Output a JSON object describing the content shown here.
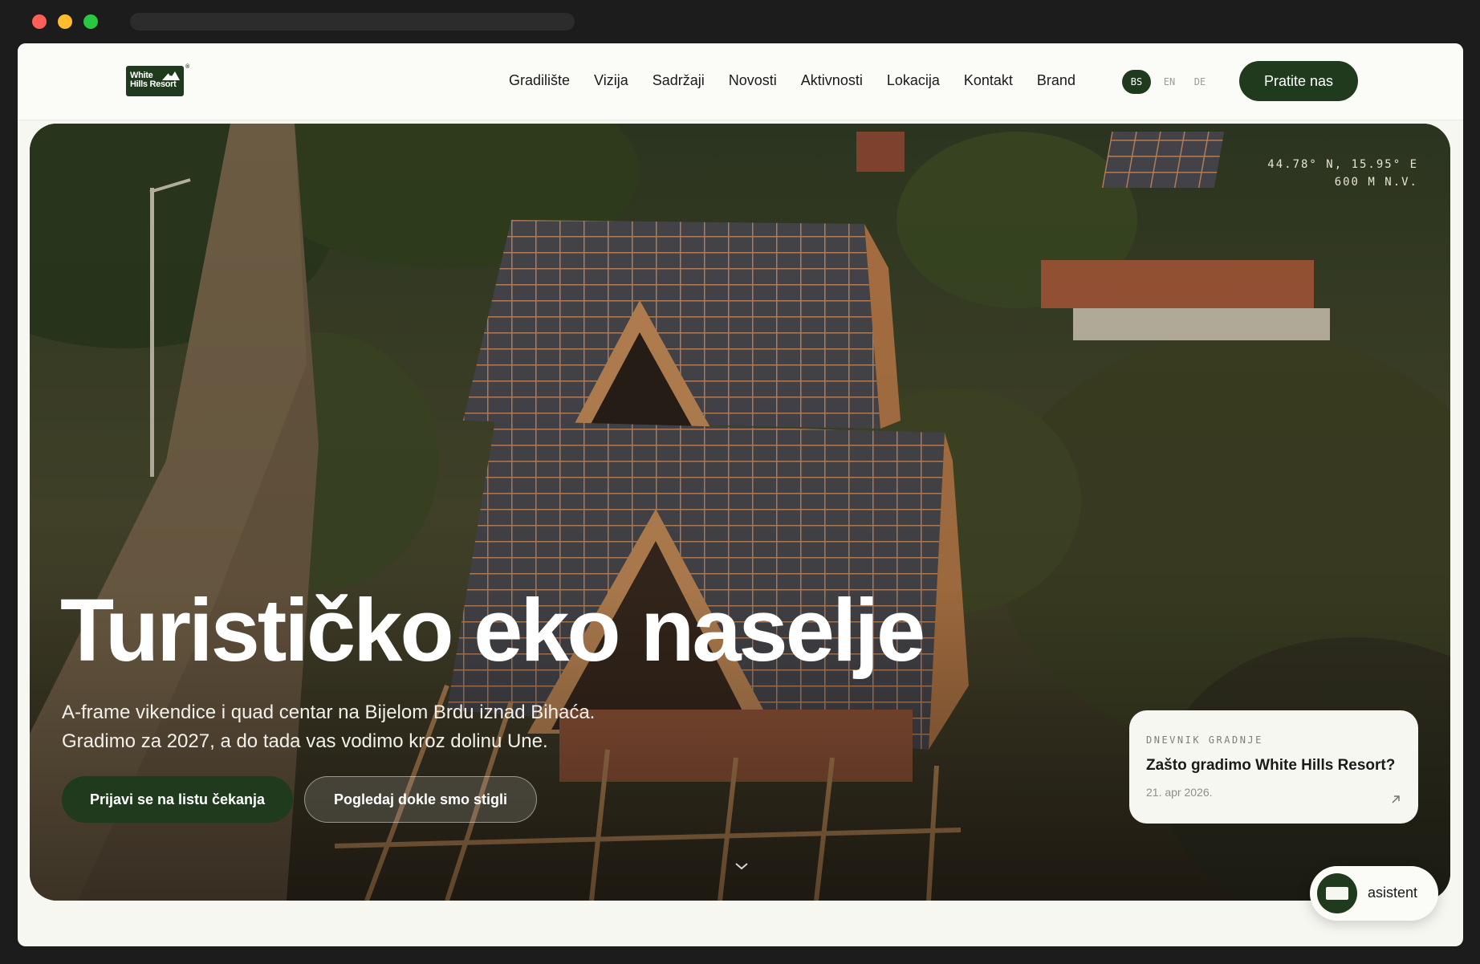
{
  "brand": {
    "logo_text_line1": "White",
    "logo_text_line2": "Hills Resort",
    "logo_reg_mark": "®"
  },
  "nav": {
    "items": [
      "Gradilište",
      "Vizija",
      "Sadržaji",
      "Novosti",
      "Aktivnosti",
      "Lokacija",
      "Kontakt",
      "Brand"
    ]
  },
  "languages": {
    "items": [
      "BS",
      "EN",
      "DE"
    ],
    "active": "BS"
  },
  "header": {
    "cta_label": "Pratite nas"
  },
  "hero": {
    "coords_line1": "44.78° N, 15.95° E",
    "coords_line2": "600 M N.V.",
    "title": "Turističko eko naselje",
    "subtitle_line1": "A-frame vikendice i quad centar na Bijelom Brdu iznad Bihaća.",
    "subtitle_line2": "Gradimo za 2027, a do tada vas vodimo kroz dolinu Une.",
    "primary_cta": "Prijavi se na listu čekanja",
    "secondary_cta": "Pogledaj dokle smo stigli"
  },
  "news_card": {
    "eyebrow": "DNEVNIK GRADNJE",
    "title": "Zašto gradimo White Hills Resort?",
    "date": "21. apr 2026."
  },
  "assistant": {
    "label": "asistent"
  },
  "colors": {
    "brand_green": "#1f3a1c",
    "page_bg": "#f6f7f1",
    "window_bg": "#1c1c1c"
  },
  "icons": [
    "chevron-down-icon",
    "arrow-up-right-icon",
    "logo-mountain-icon"
  ]
}
